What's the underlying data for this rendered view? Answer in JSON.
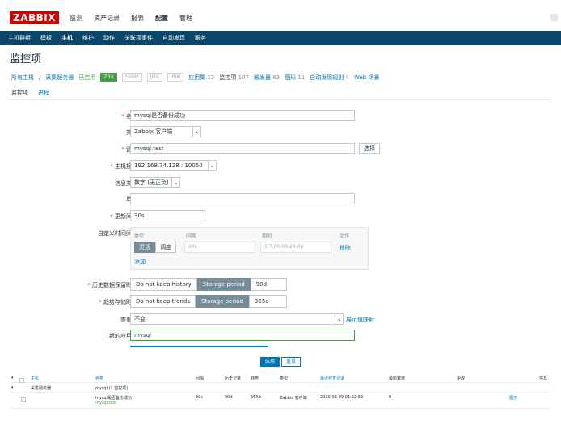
{
  "app": {
    "logo": "ZABBIX"
  },
  "top_menu": [
    "监测",
    "资产记录",
    "报表",
    "配置",
    "管理"
  ],
  "top_menu_active": "配置",
  "sub_nav": [
    "主机群组",
    "模板",
    "主机",
    "维护",
    "动作",
    "关联项事件",
    "自动发现",
    "服务"
  ],
  "sub_nav_active": "主机",
  "page_title": "监控项",
  "breadcrumb": {
    "all_hosts": "所有主机",
    "sep": "/",
    "host": "采集服务器",
    "status": "已启用",
    "tags": [
      "ZBX",
      "SNMP",
      "JMX",
      "IPMI"
    ],
    "links": [
      {
        "label": "应用集",
        "count": "12"
      },
      {
        "label": "监控项",
        "count": "107"
      },
      {
        "label": "触发器",
        "count": "63"
      },
      {
        "label": "图形",
        "count": "11"
      },
      {
        "label": "自动发现规则",
        "count": "4"
      },
      {
        "label": "Web 场景",
        "count": ""
      }
    ]
  },
  "tabs": [
    "监控项",
    "进程"
  ],
  "form": {
    "name_label": "名称",
    "name_value": "mysql是否备份成功",
    "type_label": "类型",
    "type_value": "Zabbix 客户端",
    "key_label": "键值",
    "key_value": "mysql.test",
    "key_button": "选择",
    "iface_label": "主机接口",
    "iface_value": "192.168.74.128 : 10050",
    "info_label": "信息类型",
    "info_value": "数字 (无正负)",
    "unit_label": "单位",
    "unit_value": "",
    "interval_label": "更新间隔",
    "interval_value": "30s",
    "custom_label": "自定义时间间隔",
    "custom": {
      "col_type": "类型",
      "col_interval": "间隔",
      "col_period": "期间",
      "col_action": "动作",
      "flex": "灵活",
      "schedule": "调度",
      "interval_placeholder": "50s",
      "period_placeholder": "1-7,00:00-24:00",
      "remove": "移除",
      "add": "添加"
    },
    "history_label": "历史数据保留时长",
    "history_opt1": "Do not keep history",
    "history_opt2": "Storage period",
    "history_value": "90d",
    "trend_label": "趋势存储时间",
    "trend_opt1": "Do not keep trends",
    "trend_opt2": "Storage period",
    "trend_value": "365d",
    "valuemap_label": "查看值",
    "valuemap_value": "不变",
    "valuemap_link": "展示值映射",
    "newapp_label": "新的应用集",
    "newapp_value": "mysql"
  },
  "lower_bar": {
    "apply": "应用",
    "reset": "重设"
  },
  "table": {
    "headers": [
      "主机",
      "名称",
      "间隔",
      "历史记录",
      "趋势",
      "类型",
      "最近检查记录",
      "最新数据",
      "更改",
      "信息"
    ],
    "group_row": {
      "host": "采集服务器",
      "name": "mysql (1 监控项)"
    },
    "row": {
      "name": "mysql是否备份成功",
      "key": "mysql.test",
      "interval": "30s",
      "history": "90d",
      "trends": "365d",
      "type": "Zabbix 客户端",
      "lastcheck": "2020-03-09 01:22:59",
      "lastvalue": "0",
      "graph": "图形"
    }
  }
}
